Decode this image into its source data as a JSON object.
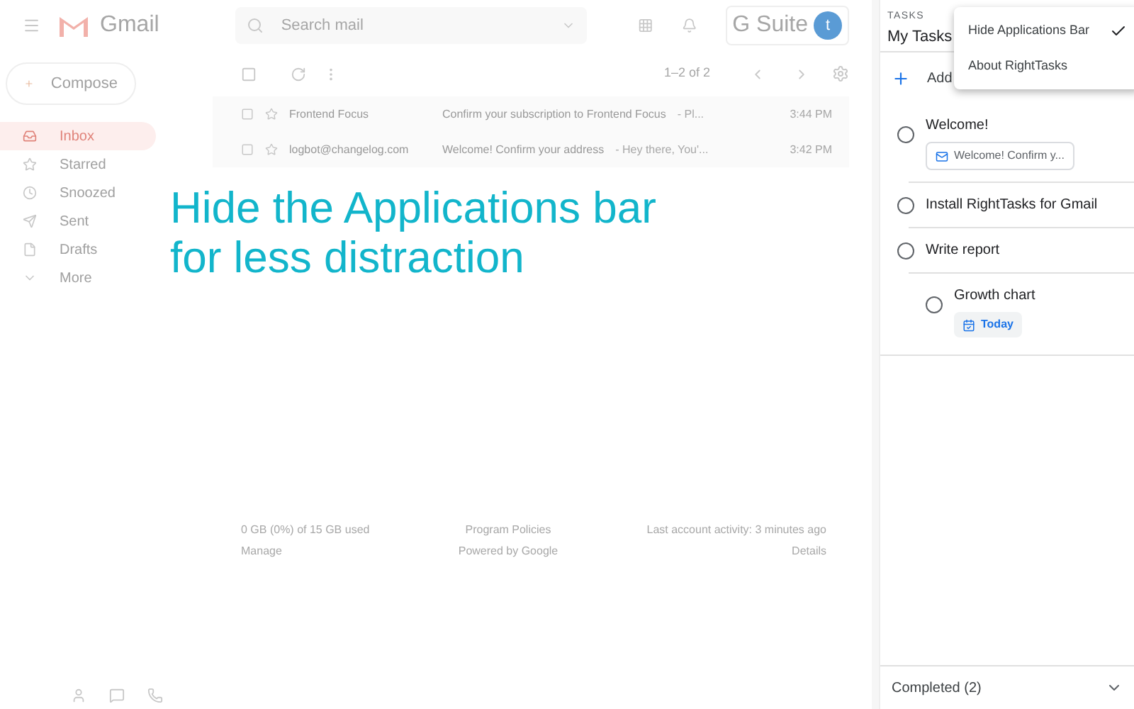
{
  "gmail": {
    "logo": "Gmail",
    "search": {
      "placeholder": "Search mail"
    },
    "suite": "G Suite",
    "avatar": "t",
    "compose": "Compose",
    "nav": [
      {
        "label": "Inbox",
        "selected": true
      },
      {
        "label": "Starred",
        "selected": false
      },
      {
        "label": "Snoozed",
        "selected": false
      },
      {
        "label": "Sent",
        "selected": false
      },
      {
        "label": "Drafts",
        "selected": false
      },
      {
        "label": "More",
        "selected": false
      }
    ],
    "pager": "1–2 of 2",
    "emails": [
      {
        "sender": "Frontend Focus",
        "subject": "Confirm your subscription to Frontend Focus",
        "snippet": "- Pl...",
        "time": "3:44 PM"
      },
      {
        "sender": "logbot@changelog.com",
        "subject": "Welcome! Confirm your address",
        "snippet": "- Hey there, You'...",
        "time": "3:42 PM"
      }
    ],
    "footer": [
      [
        "0 GB (0%) of 15 GB used",
        "Manage"
      ],
      [
        "Program Policies",
        "Powered by Google"
      ],
      [
        "Last account activity: 3 minutes ago",
        "Details"
      ]
    ]
  },
  "headline": "Hide the Applications bar for less distraction",
  "tasks": {
    "label": "TASKS",
    "list": "My Tasks",
    "add": "Add",
    "menu": [
      {
        "label": "Hide Applications Bar",
        "checked": true
      },
      {
        "label": "About RightTasks",
        "checked": false
      }
    ],
    "items": [
      {
        "title": "Welcome!",
        "checked": false,
        "chip": {
          "kind": "email",
          "text": "Welcome! Confirm y..."
        }
      },
      {
        "title": "Install RightTasks for Gmail",
        "checked": false
      },
      {
        "title": "Write report",
        "checked": false,
        "children": [
          {
            "title": "Growth chart",
            "checked": false,
            "chip": {
              "kind": "date",
              "text": "Today"
            }
          }
        ]
      }
    ],
    "completed": "Completed (2)"
  }
}
